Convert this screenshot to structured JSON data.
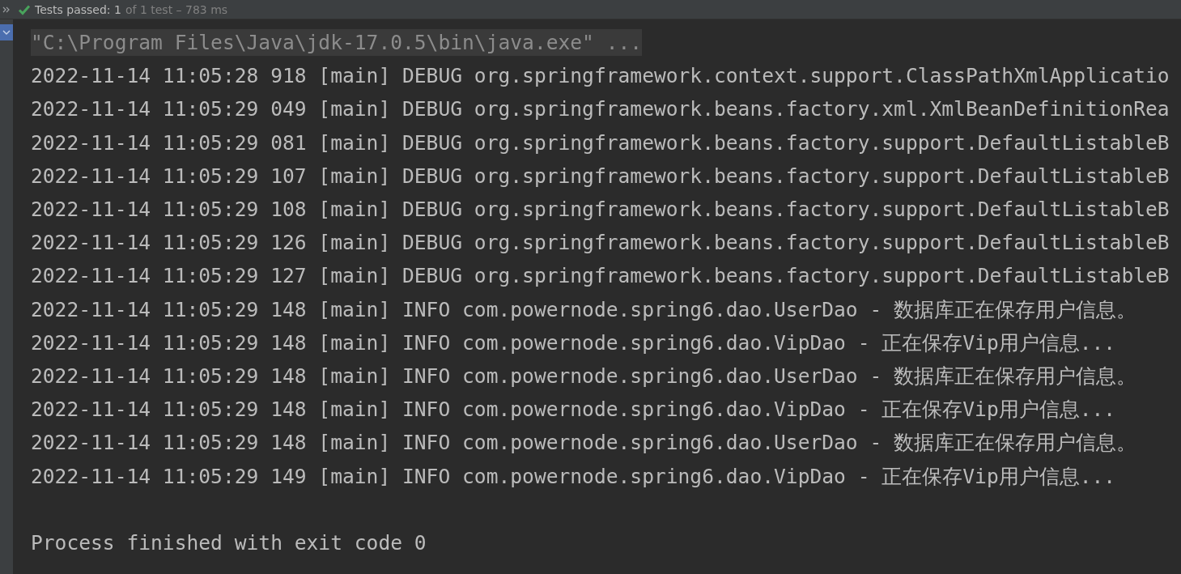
{
  "status_bar": {
    "status": "Tests passed: 1",
    "detail": "of 1 test – 783 ms",
    "passed": true
  },
  "console": {
    "expanded": true,
    "lines": [
      {
        "kind": "command",
        "text": "\"C:\\Program Files\\Java\\jdk-17.0.5\\bin\\java.exe\" ..."
      },
      {
        "kind": "log",
        "text": "2022-11-14 11:05:28 918 [main] DEBUG org.springframework.context.support.ClassPathXmlApplicatio"
      },
      {
        "kind": "log",
        "text": "2022-11-14 11:05:29 049 [main] DEBUG org.springframework.beans.factory.xml.XmlBeanDefinitionRea"
      },
      {
        "kind": "log",
        "text": "2022-11-14 11:05:29 081 [main] DEBUG org.springframework.beans.factory.support.DefaultListableB"
      },
      {
        "kind": "log",
        "text": "2022-11-14 11:05:29 107 [main] DEBUG org.springframework.beans.factory.support.DefaultListableB"
      },
      {
        "kind": "log",
        "text": "2022-11-14 11:05:29 108 [main] DEBUG org.springframework.beans.factory.support.DefaultListableB"
      },
      {
        "kind": "log",
        "text": "2022-11-14 11:05:29 126 [main] DEBUG org.springframework.beans.factory.support.DefaultListableB"
      },
      {
        "kind": "log",
        "text": "2022-11-14 11:05:29 127 [main] DEBUG org.springframework.beans.factory.support.DefaultListableB"
      },
      {
        "kind": "log",
        "text": "2022-11-14 11:05:29 148 [main] INFO com.powernode.spring6.dao.UserDao - 数据库正在保存用户信息。"
      },
      {
        "kind": "log",
        "text": "2022-11-14 11:05:29 148 [main] INFO com.powernode.spring6.dao.VipDao - 正在保存Vip用户信息..."
      },
      {
        "kind": "log",
        "text": "2022-11-14 11:05:29 148 [main] INFO com.powernode.spring6.dao.UserDao - 数据库正在保存用户信息。"
      },
      {
        "kind": "log",
        "text": "2022-11-14 11:05:29 148 [main] INFO com.powernode.spring6.dao.VipDao - 正在保存Vip用户信息..."
      },
      {
        "kind": "log",
        "text": "2022-11-14 11:05:29 148 [main] INFO com.powernode.spring6.dao.UserDao - 数据库正在保存用户信息。"
      },
      {
        "kind": "log",
        "text": "2022-11-14 11:05:29 149 [main] INFO com.powernode.spring6.dao.VipDao - 正在保存Vip用户信息..."
      },
      {
        "kind": "blank"
      },
      {
        "kind": "log",
        "text": "Process finished with exit code 0"
      }
    ]
  }
}
